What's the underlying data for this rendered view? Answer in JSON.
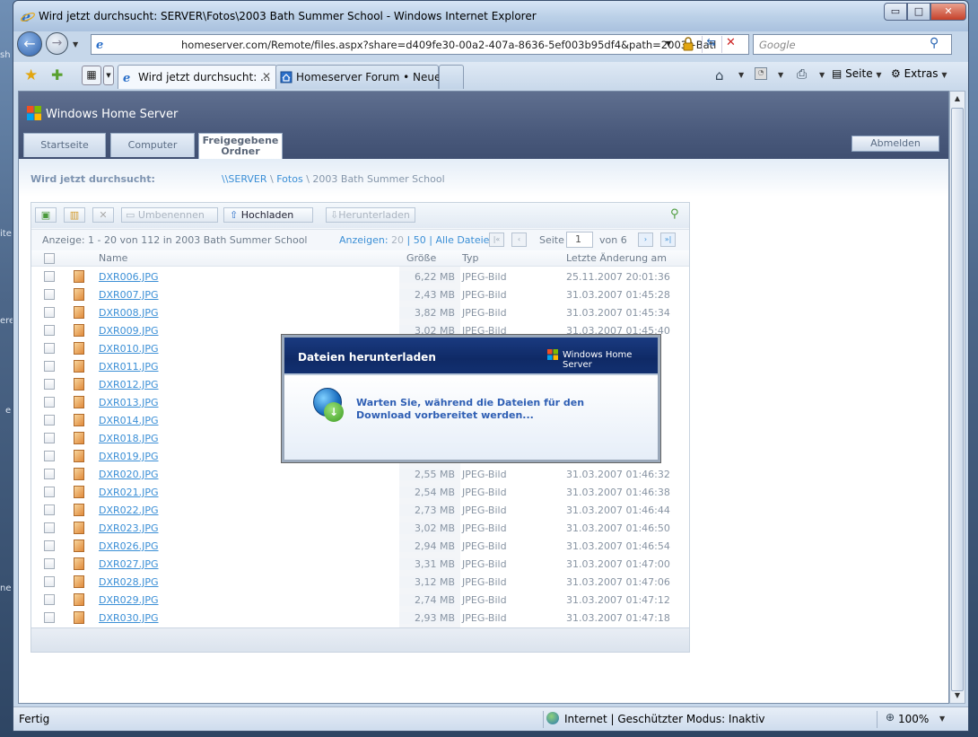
{
  "window": {
    "title": "Wird jetzt durchsucht: SERVER\\Fotos\\2003 Bath Summer School - Windows Internet Explorer",
    "btn_min": "▭",
    "btn_max": "□",
    "btn_close": "✕"
  },
  "address": {
    "url": "homeserver.com/Remote/files.aspx?share=d409fe30-00a2-407a-8636-5ef003b95df4&path=2003+Batl"
  },
  "search": {
    "placeholder": "Google"
  },
  "tabs": [
    {
      "label": "Wird jetzt durchsucht: ..."
    },
    {
      "label": "Homeserver Forum • Neue..."
    }
  ],
  "command_bar": {
    "page": "Seite",
    "tools": "Extras"
  },
  "whs": {
    "title": "Windows Home Server",
    "nav": [
      "Startseite",
      "Computer",
      "Freigegebene",
      "Ordner"
    ],
    "logout": "Abmelden",
    "browse_label": "Wird jetzt durchsucht:",
    "crumb": {
      "server": "\\\\SERVER",
      "sep": "\\",
      "share": "Fotos",
      "folder": "2003 Bath Summer School"
    }
  },
  "panel": {
    "toolbar": {
      "rename": "Umbenennen",
      "upload": "Hochladen",
      "download": "Herunterladen"
    },
    "info": "Anzeige: 1 - 20 von 112 in 2003 Bath Summer School",
    "show": {
      "label": "Anzeigen:",
      "opt1": "20",
      "opt2": "50",
      "opt3": "Alle Dateien"
    },
    "pager": {
      "label": "Seite",
      "current": "1",
      "of": "von 6"
    },
    "columns": {
      "name": "Name",
      "size": "Größe",
      "type": "Typ",
      "modified": "Letzte Änderung am"
    }
  },
  "files": [
    {
      "name": "DXR006.JPG",
      "size": "6,22 MB",
      "type": "JPEG-Bild",
      "date": "25.11.2007 20:01:36"
    },
    {
      "name": "DXR007.JPG",
      "size": "2,43 MB",
      "type": "JPEG-Bild",
      "date": "31.03.2007 01:45:28"
    },
    {
      "name": "DXR008.JPG",
      "size": "3,82 MB",
      "type": "JPEG-Bild",
      "date": "31.03.2007 01:45:34"
    },
    {
      "name": "DXR009.JPG",
      "size": "3,02 MB",
      "type": "JPEG-Bild",
      "date": "31.03.2007 01:45:40"
    },
    {
      "name": "DXR010.JPG",
      "size": "",
      "type": "",
      "date": ""
    },
    {
      "name": "DXR011.JPG",
      "size": "",
      "type": "",
      "date": ""
    },
    {
      "name": "DXR012.JPG",
      "size": "",
      "type": "",
      "date": ""
    },
    {
      "name": "DXR013.JPG",
      "size": "",
      "type": "",
      "date": ""
    },
    {
      "name": "DXR014.JPG",
      "size": "",
      "type": "",
      "date": ""
    },
    {
      "name": "DXR018.JPG",
      "size": "",
      "type": "",
      "date": ""
    },
    {
      "name": "DXR019.JPG",
      "size": "",
      "type": "",
      "date": ""
    },
    {
      "name": "DXR020.JPG",
      "size": "2,55 MB",
      "type": "JPEG-Bild",
      "date": "31.03.2007 01:46:32"
    },
    {
      "name": "DXR021.JPG",
      "size": "2,54 MB",
      "type": "JPEG-Bild",
      "date": "31.03.2007 01:46:38"
    },
    {
      "name": "DXR022.JPG",
      "size": "2,73 MB",
      "type": "JPEG-Bild",
      "date": "31.03.2007 01:46:44"
    },
    {
      "name": "DXR023.JPG",
      "size": "3,02 MB",
      "type": "JPEG-Bild",
      "date": "31.03.2007 01:46:50"
    },
    {
      "name": "DXR026.JPG",
      "size": "2,94 MB",
      "type": "JPEG-Bild",
      "date": "31.03.2007 01:46:54"
    },
    {
      "name": "DXR027.JPG",
      "size": "3,31 MB",
      "type": "JPEG-Bild",
      "date": "31.03.2007 01:47:00"
    },
    {
      "name": "DXR028.JPG",
      "size": "3,12 MB",
      "type": "JPEG-Bild",
      "date": "31.03.2007 01:47:06"
    },
    {
      "name": "DXR029.JPG",
      "size": "2,74 MB",
      "type": "JPEG-Bild",
      "date": "31.03.2007 01:47:12"
    },
    {
      "name": "DXR030.JPG",
      "size": "2,93 MB",
      "type": "JPEG-Bild",
      "date": "31.03.2007 01:47:18"
    }
  ],
  "dialog": {
    "title": "Dateien herunterladen",
    "brand": "Windows Home Server",
    "message": "Warten Sie, während die Dateien für den Download vorbereitet werden..."
  },
  "status": {
    "text": "Fertig",
    "zone": "Internet | Geschützter Modus: Inaktiv",
    "zoom": "100%"
  },
  "desktop_edge": [
    "sh",
    "ite",
    "ere",
    "e",
    "ne"
  ],
  "colors": {
    "link": "#3b8fd6",
    "whs_header": "#4a5a7c",
    "dialog_header": "#0f2a66"
  }
}
